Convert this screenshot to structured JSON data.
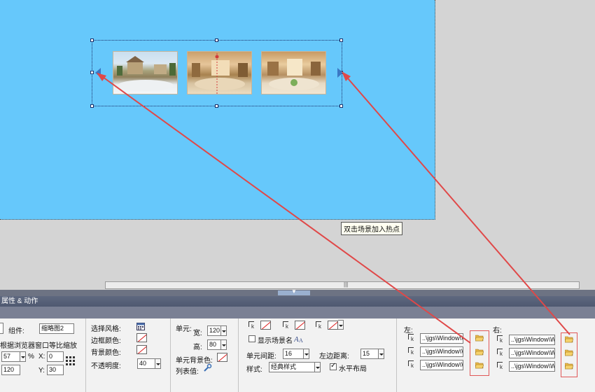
{
  "tooltip": "双击场景加入热点",
  "panel_title": "属性 & 动作",
  "colors": {
    "canvas": "#66c8fb",
    "annotation_arrow": "#e04848",
    "panel_bar": "#5f6980"
  },
  "thumbnails": [
    {
      "name": "exterior-garden-panorama"
    },
    {
      "name": "living-room-panorama"
    },
    {
      "name": "lounge-panorama"
    }
  ],
  "component": {
    "label": "组件:",
    "name": "缩略图2",
    "scale_label": "根据浏览器窗口等比缩放",
    "scale_value": "57",
    "scale_unit": "%",
    "x_label": "X:",
    "x_value": "0",
    "y_label": "Y:",
    "y_value": "30",
    "h_value": "120"
  },
  "style": {
    "select_style": "选择风格:",
    "border_color": "边框颜色:",
    "bg_color": "背景颜色:",
    "opacity_label": "不透明度:",
    "opacity_value": "40"
  },
  "cell": {
    "title": "单元:",
    "width_label": "宽:",
    "width_value": "120",
    "height_label": "高:",
    "height_value": "80",
    "bg_label": "单元背景色:",
    "list_label": "列表值:"
  },
  "layout": {
    "show_name": "显示场景名",
    "cell_spacing_label": "单元间距:",
    "cell_spacing_value": "16",
    "left_margin_label": "左边距离:",
    "left_margin_value": "15",
    "style_label": "样式:",
    "style_value": "经典样式",
    "horizontal_label": "水平布局"
  },
  "left_group": {
    "title": "左:",
    "paths": [
      "..\\jgs\\Window\\Wi",
      "..\\jgs\\Window\\Wi",
      "..\\jgs\\Window\\Wi"
    ]
  },
  "right_group": {
    "title": "右:",
    "paths": [
      "..\\jgs\\Window\\Wi",
      "..\\jgs\\Window\\Wi",
      "..\\jgs\\Window\\Wi"
    ]
  }
}
